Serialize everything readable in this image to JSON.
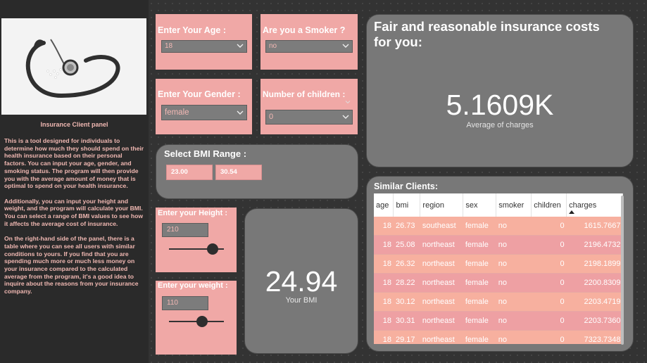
{
  "left_panel": {
    "title": "Insurance Client panel",
    "description": [
      "This is a tool designed for individuals to determine how much they should spend on their health insurance based on their personal factors. You can input your age, gender, and smoking status. The program will then provide you with the average amount of money that is optimal to spend on your health insurance.",
      "Additionally, you can input your height and weight, and the program will calculate your BMI. You can select a range of BMI values to see how it affects the average cost of insurance.",
      "On the right-hand side of the panel, there is a table where you can see all users with similar conditions to yours. If you find that you are spending much more or much less money on your insurance compared to the calculated average from the program, it's a good idea to inquire about the reasons from your insurance company."
    ]
  },
  "filters": {
    "age": {
      "label": "Enter Your Age :",
      "value": "18"
    },
    "smoker": {
      "label": "Are you a Smoker ?",
      "value": "no"
    },
    "gender": {
      "label": "Enter Your Gender :",
      "value": "female"
    },
    "children": {
      "label": "Number of children :",
      "value": "0"
    }
  },
  "bmi_range": {
    "label": "Select BMI Range :",
    "min": "23.00",
    "max": "30.54"
  },
  "height": {
    "label": "Enter your Height :",
    "value": "210",
    "slider_fraction": 0.8
  },
  "weight": {
    "label": "Enter your weight :",
    "value": "110",
    "slider_fraction": 0.6
  },
  "bmi_card": {
    "value": "24.94",
    "label": "Your BMI"
  },
  "insurance_card": {
    "title": "Fair and reasonable insurance costs for you:",
    "value": "5.1609K",
    "label": "Average of charges"
  },
  "similar_clients": {
    "title": "Similar Clients:",
    "columns": [
      "age",
      "bmi",
      "region",
      "sex",
      "smoker",
      "children",
      "charges"
    ],
    "rows": [
      [
        "18",
        "26.73",
        "southeast",
        "female",
        "no",
        "0",
        "1615.7667"
      ],
      [
        "18",
        "25.08",
        "northeast",
        "female",
        "no",
        "0",
        "2196.4732"
      ],
      [
        "18",
        "26.32",
        "northeast",
        "female",
        "no",
        "0",
        "2198.1899"
      ],
      [
        "18",
        "28.22",
        "northeast",
        "female",
        "no",
        "0",
        "2200.8309"
      ],
      [
        "18",
        "30.12",
        "northeast",
        "female",
        "no",
        "0",
        "2203.4719"
      ],
      [
        "18",
        "30.31",
        "northeast",
        "female",
        "no",
        "0",
        "2203.7360"
      ],
      [
        "18",
        "29.17",
        "northeast",
        "female",
        "no",
        "0",
        "7323.7348"
      ]
    ]
  },
  "colors": {
    "pink_card": "#f0a8a6",
    "grey_card": "#787878",
    "background": "#333333",
    "row_odd": "#f7b09f",
    "row_even": "#eea0a3"
  },
  "icons": [
    "stethoscope-image",
    "chevron-down-icon",
    "sort-arrow-icon"
  ]
}
